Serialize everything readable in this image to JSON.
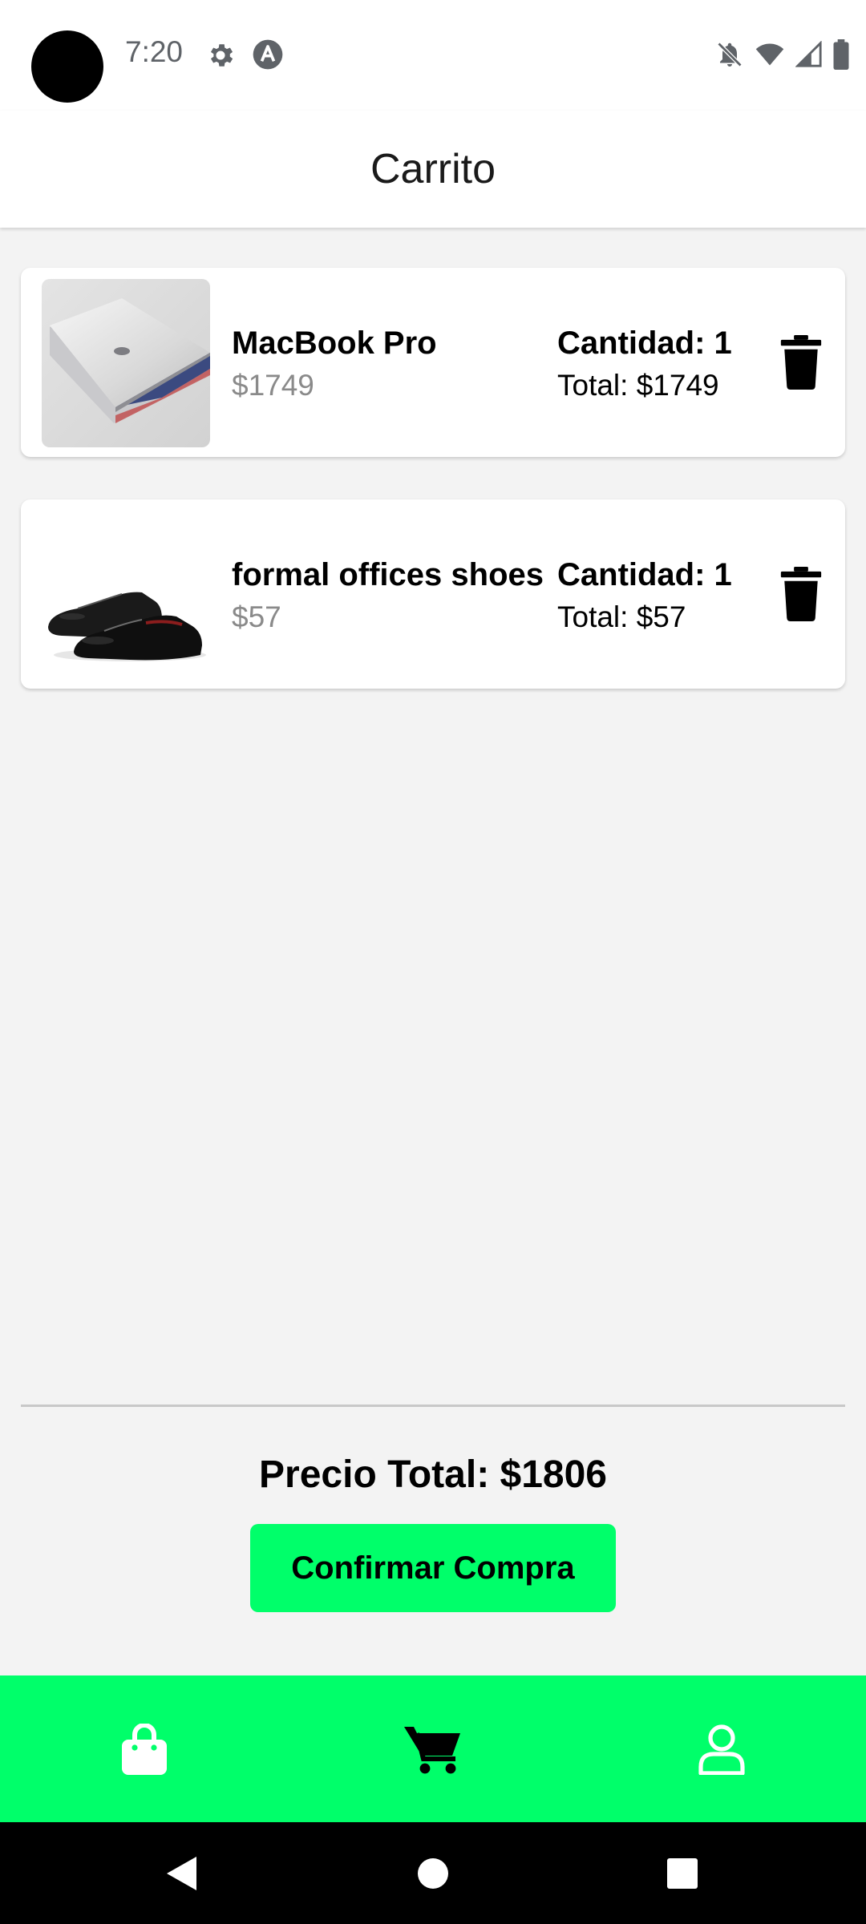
{
  "status_bar": {
    "time": "7:20",
    "icons": [
      "gear-icon",
      "a-circle-icon",
      "notifications-off-icon",
      "wifi-icon",
      "cell-signal-icon",
      "battery-icon"
    ]
  },
  "header": {
    "title": "Carrito"
  },
  "cart": {
    "items": [
      {
        "name": "MacBook Pro",
        "price": "$1749",
        "quantity": "Cantidad: 1",
        "total": "Total: $1749",
        "image": "laptop-image"
      },
      {
        "name": "formal offices shoes",
        "price": "$57",
        "quantity": "Cantidad: 1",
        "total": "Total: $57",
        "image": "shoes-image"
      }
    ]
  },
  "summary": {
    "total_label": "Precio Total: $1806",
    "confirm_label": "Confirmar Compra"
  },
  "bottom_nav": {
    "items": [
      {
        "icon": "shopping-bag-icon",
        "active": false
      },
      {
        "icon": "cart-icon",
        "active": true
      },
      {
        "icon": "user-icon",
        "active": false
      }
    ]
  },
  "colors": {
    "accent": "#00ff6a",
    "background": "#f3f3f3",
    "card": "#ffffff",
    "price_muted": "#8a8a8a"
  }
}
